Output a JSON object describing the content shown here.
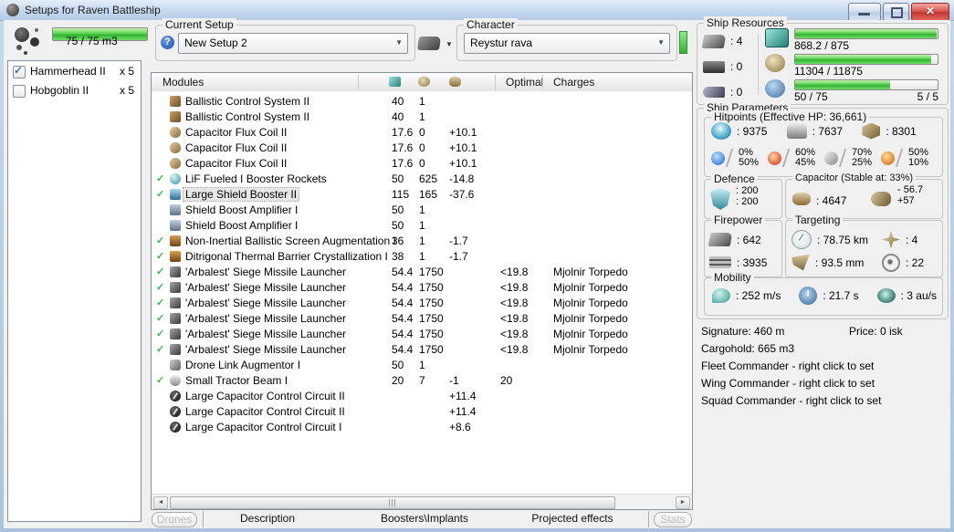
{
  "colors": {
    "bar_green": "#3fc93f",
    "check_green": "#3ab54a",
    "close_red": "#bf372f",
    "title_blue": "#c3d6ec"
  },
  "icons": {
    "close": "✕",
    "dropdown": "▼",
    "scroll_left": "◄",
    "scroll_right": "►",
    "check": "✓",
    "help": "?"
  },
  "window": {
    "title": "Setups for Raven Battleship"
  },
  "drone_bay": {
    "bar_pct": 100,
    "capacity": "75 / 75 m3",
    "drones": [
      {
        "name": "Hammerhead II",
        "qty": "x 5",
        "state": "checked"
      },
      {
        "name": "Hobgoblin II",
        "qty": "x 5",
        "state": ""
      }
    ]
  },
  "current_setup": {
    "label": "Current Setup",
    "value": "New Setup 2"
  },
  "character": {
    "label": "Character",
    "value": "Reystur rava"
  },
  "modules_table": {
    "title": "Modules",
    "col_optimal": "Optimal",
    "col_charges": "Charges",
    "rows": [
      {
        "chk": "",
        "icon": "i-bcs",
        "name": "Ballistic Control System II",
        "cpu": "40",
        "pg": "1",
        "cap": "",
        "opt": "",
        "charge": "",
        "sel": ""
      },
      {
        "chk": "",
        "icon": "i-bcs",
        "name": "Ballistic Control System II",
        "cpu": "40",
        "pg": "1",
        "cap": "",
        "opt": "",
        "charge": "",
        "sel": ""
      },
      {
        "chk": "",
        "icon": "i-cap",
        "name": "Capacitor Flux Coil II",
        "cpu": "17.6",
        "pg": "0",
        "cap": "+10.1",
        "opt": "",
        "charge": "",
        "sel": ""
      },
      {
        "chk": "",
        "icon": "i-cap",
        "name": "Capacitor Flux Coil II",
        "cpu": "17.6",
        "pg": "0",
        "cap": "+10.1",
        "opt": "",
        "charge": "",
        "sel": ""
      },
      {
        "chk": "",
        "icon": "i-cap",
        "name": "Capacitor Flux Coil II",
        "cpu": "17.6",
        "pg": "0",
        "cap": "+10.1",
        "opt": "",
        "charge": "",
        "sel": ""
      },
      {
        "chk": "✓",
        "icon": "i-rocket",
        "name": "LiF Fueled I Booster Rockets",
        "cpu": "50",
        "pg": "625",
        "cap": "-14.8",
        "opt": "",
        "charge": "",
        "sel": ""
      },
      {
        "chk": "✓",
        "icon": "i-lsb",
        "name": "Large Shield Booster II",
        "cpu": "115",
        "pg": "165",
        "cap": "-37.6",
        "opt": "",
        "charge": "",
        "sel": "sel"
      },
      {
        "chk": "",
        "icon": "i-sba",
        "name": "Shield Boost Amplifier I",
        "cpu": "50",
        "pg": "1",
        "cap": "",
        "opt": "",
        "charge": "",
        "sel": ""
      },
      {
        "chk": "",
        "icon": "i-sba",
        "name": "Shield Boost Amplifier I",
        "cpu": "50",
        "pg": "1",
        "cap": "",
        "opt": "",
        "charge": "",
        "sel": ""
      },
      {
        "chk": "✓",
        "icon": "i-rig",
        "name": "Non-Inertial Ballistic Screen Augmentation I",
        "cpu": "36",
        "pg": "1",
        "cap": "-1.7",
        "opt": "",
        "charge": "",
        "sel": ""
      },
      {
        "chk": "✓",
        "icon": "i-rig",
        "name": "Ditrigonal Thermal Barrier Crystallization I",
        "cpu": "38",
        "pg": "1",
        "cap": "-1.7",
        "opt": "",
        "charge": "",
        "sel": ""
      },
      {
        "chk": "✓",
        "icon": "i-launcher",
        "name": "'Arbalest' Siege Missile Launcher",
        "cpu": "54.4",
        "pg": "1750",
        "cap": "",
        "opt": "<19.8",
        "charge": "Mjolnir Torpedo",
        "sel": ""
      },
      {
        "chk": "✓",
        "icon": "i-launcher",
        "name": "'Arbalest' Siege Missile Launcher",
        "cpu": "54.4",
        "pg": "1750",
        "cap": "",
        "opt": "<19.8",
        "charge": "Mjolnir Torpedo",
        "sel": ""
      },
      {
        "chk": "✓",
        "icon": "i-launcher",
        "name": "'Arbalest' Siege Missile Launcher",
        "cpu": "54.4",
        "pg": "1750",
        "cap": "",
        "opt": "<19.8",
        "charge": "Mjolnir Torpedo",
        "sel": ""
      },
      {
        "chk": "✓",
        "icon": "i-launcher",
        "name": "'Arbalest' Siege Missile Launcher",
        "cpu": "54.4",
        "pg": "1750",
        "cap": "",
        "opt": "<19.8",
        "charge": "Mjolnir Torpedo",
        "sel": ""
      },
      {
        "chk": "✓",
        "icon": "i-launcher",
        "name": "'Arbalest' Siege Missile Launcher",
        "cpu": "54.4",
        "pg": "1750",
        "cap": "",
        "opt": "<19.8",
        "charge": "Mjolnir Torpedo",
        "sel": ""
      },
      {
        "chk": "✓",
        "icon": "i-launcher",
        "name": "'Arbalest' Siege Missile Launcher",
        "cpu": "54.4",
        "pg": "1750",
        "cap": "",
        "opt": "<19.8",
        "charge": "Mjolnir Torpedo",
        "sel": ""
      },
      {
        "chk": "",
        "icon": "i-drone",
        "name": "Drone Link Augmentor I",
        "cpu": "50",
        "pg": "1",
        "cap": "",
        "opt": "",
        "charge": "",
        "sel": ""
      },
      {
        "chk": "✓",
        "icon": "i-tractor",
        "name": "Small Tractor Beam I",
        "cpu": "20",
        "pg": "7",
        "cap": "-1",
        "opt": "20",
        "charge": "",
        "sel": ""
      },
      {
        "chk": "",
        "icon": "i-ccc",
        "name": "Large Capacitor Control Circuit II",
        "cpu": "",
        "pg": "",
        "cap": "+11.4",
        "opt": "",
        "charge": "",
        "sel": ""
      },
      {
        "chk": "",
        "icon": "i-ccc",
        "name": "Large Capacitor Control Circuit II",
        "cpu": "",
        "pg": "",
        "cap": "+11.4",
        "opt": "",
        "charge": "",
        "sel": ""
      },
      {
        "chk": "",
        "icon": "i-ccc",
        "name": "Large Capacitor Control Circuit I",
        "cpu": "",
        "pg": "",
        "cap": "+8.6",
        "opt": "",
        "charge": "",
        "sel": ""
      }
    ]
  },
  "bottom_tabs": [
    {
      "label": "Drones",
      "cls": "pos-drones tab-disabled"
    },
    {
      "label": "Description",
      "cls": "pos-desc"
    },
    {
      "label": "Boosters\\Implants",
      "cls": "pos-boosters"
    },
    {
      "label": "Projected effects",
      "cls": "pos-projected"
    },
    {
      "label": "Stats",
      "cls": "pos-stats tab-disabled"
    }
  ],
  "resources": {
    "title": "Ship Resources",
    "slots": [
      {
        "icon": "ic-turret",
        "value": ": 4"
      },
      {
        "icon": "ic-launcherhp",
        "value": ": 0"
      },
      {
        "icon": "ic-rigslot",
        "value": ": 0"
      }
    ],
    "bars": [
      {
        "icon": "ic-cpu",
        "pct": 99.2,
        "text": "868.2 / 875",
        "extra": ""
      },
      {
        "icon": "ic-pg",
        "pct": 95.2,
        "text": "11304 / 11875",
        "extra": ""
      },
      {
        "icon": "ic-calib",
        "pct": 66.7,
        "text": "50 / 75",
        "extra": "5 / 5"
      }
    ]
  },
  "parameters": {
    "title": "Ship Parameters",
    "hitpoints": {
      "title": "Hitpoints (Effective HP: 36,661)",
      "hp": [
        {
          "icon": "ic-shield",
          "value": ": 9375"
        },
        {
          "icon": "ic-armor",
          "value": ": 7637"
        },
        {
          "icon": "ic-hull",
          "value": ": 8301"
        }
      ],
      "resists": [
        {
          "cls": "r-em",
          "top": "0%",
          "bottom": "50%"
        },
        {
          "cls": "r-th",
          "top": "60%",
          "bottom": "45%"
        },
        {
          "cls": "r-kin",
          "top": "70%",
          "bottom": "25%"
        },
        {
          "cls": "r-exp",
          "top": "50%",
          "bottom": "10%"
        }
      ]
    },
    "defence": {
      "title": "Defence",
      "line1": ": 200",
      "line2": ": 200"
    },
    "capacitor": {
      "title": "Capacitor (Stable at: 33%)",
      "amount": ": 4647",
      "peak_top": "- 56.7",
      "peak_bottom": "+57"
    },
    "firepower": {
      "title": "Firepower",
      "stats": [
        {
          "icon": "ic-turret",
          "value": ": 642"
        },
        {
          "icon": "ic-missiles",
          "value": ": 3935"
        }
      ]
    },
    "targeting": {
      "title": "Targeting",
      "stats": [
        {
          "icon": "ic-radar",
          "value": ": 78.75 km"
        },
        {
          "icon": "ic-compass",
          "value": ": 4"
        },
        {
          "icon": "ic-dish",
          "value": ": 93.5 mm"
        },
        {
          "icon": "ic-target",
          "value": ": 22"
        }
      ]
    },
    "mobility": {
      "title": "Mobility",
      "stats": [
        {
          "icon": "ic-speed",
          "value": ": 252 m/s"
        },
        {
          "icon": "ic-clock",
          "value": ": 21.7 s"
        },
        {
          "icon": "ic-warp",
          "value": ": 3 au/s"
        }
      ]
    },
    "info": {
      "signature": "Signature: 460 m",
      "price": "Price: 0 isk",
      "cargohold": "Cargohold: 665 m3",
      "fleet": "Fleet Commander - right click to set",
      "wing": "Wing Commander - right click to set",
      "squad": "Squad Commander - right click to set"
    }
  }
}
